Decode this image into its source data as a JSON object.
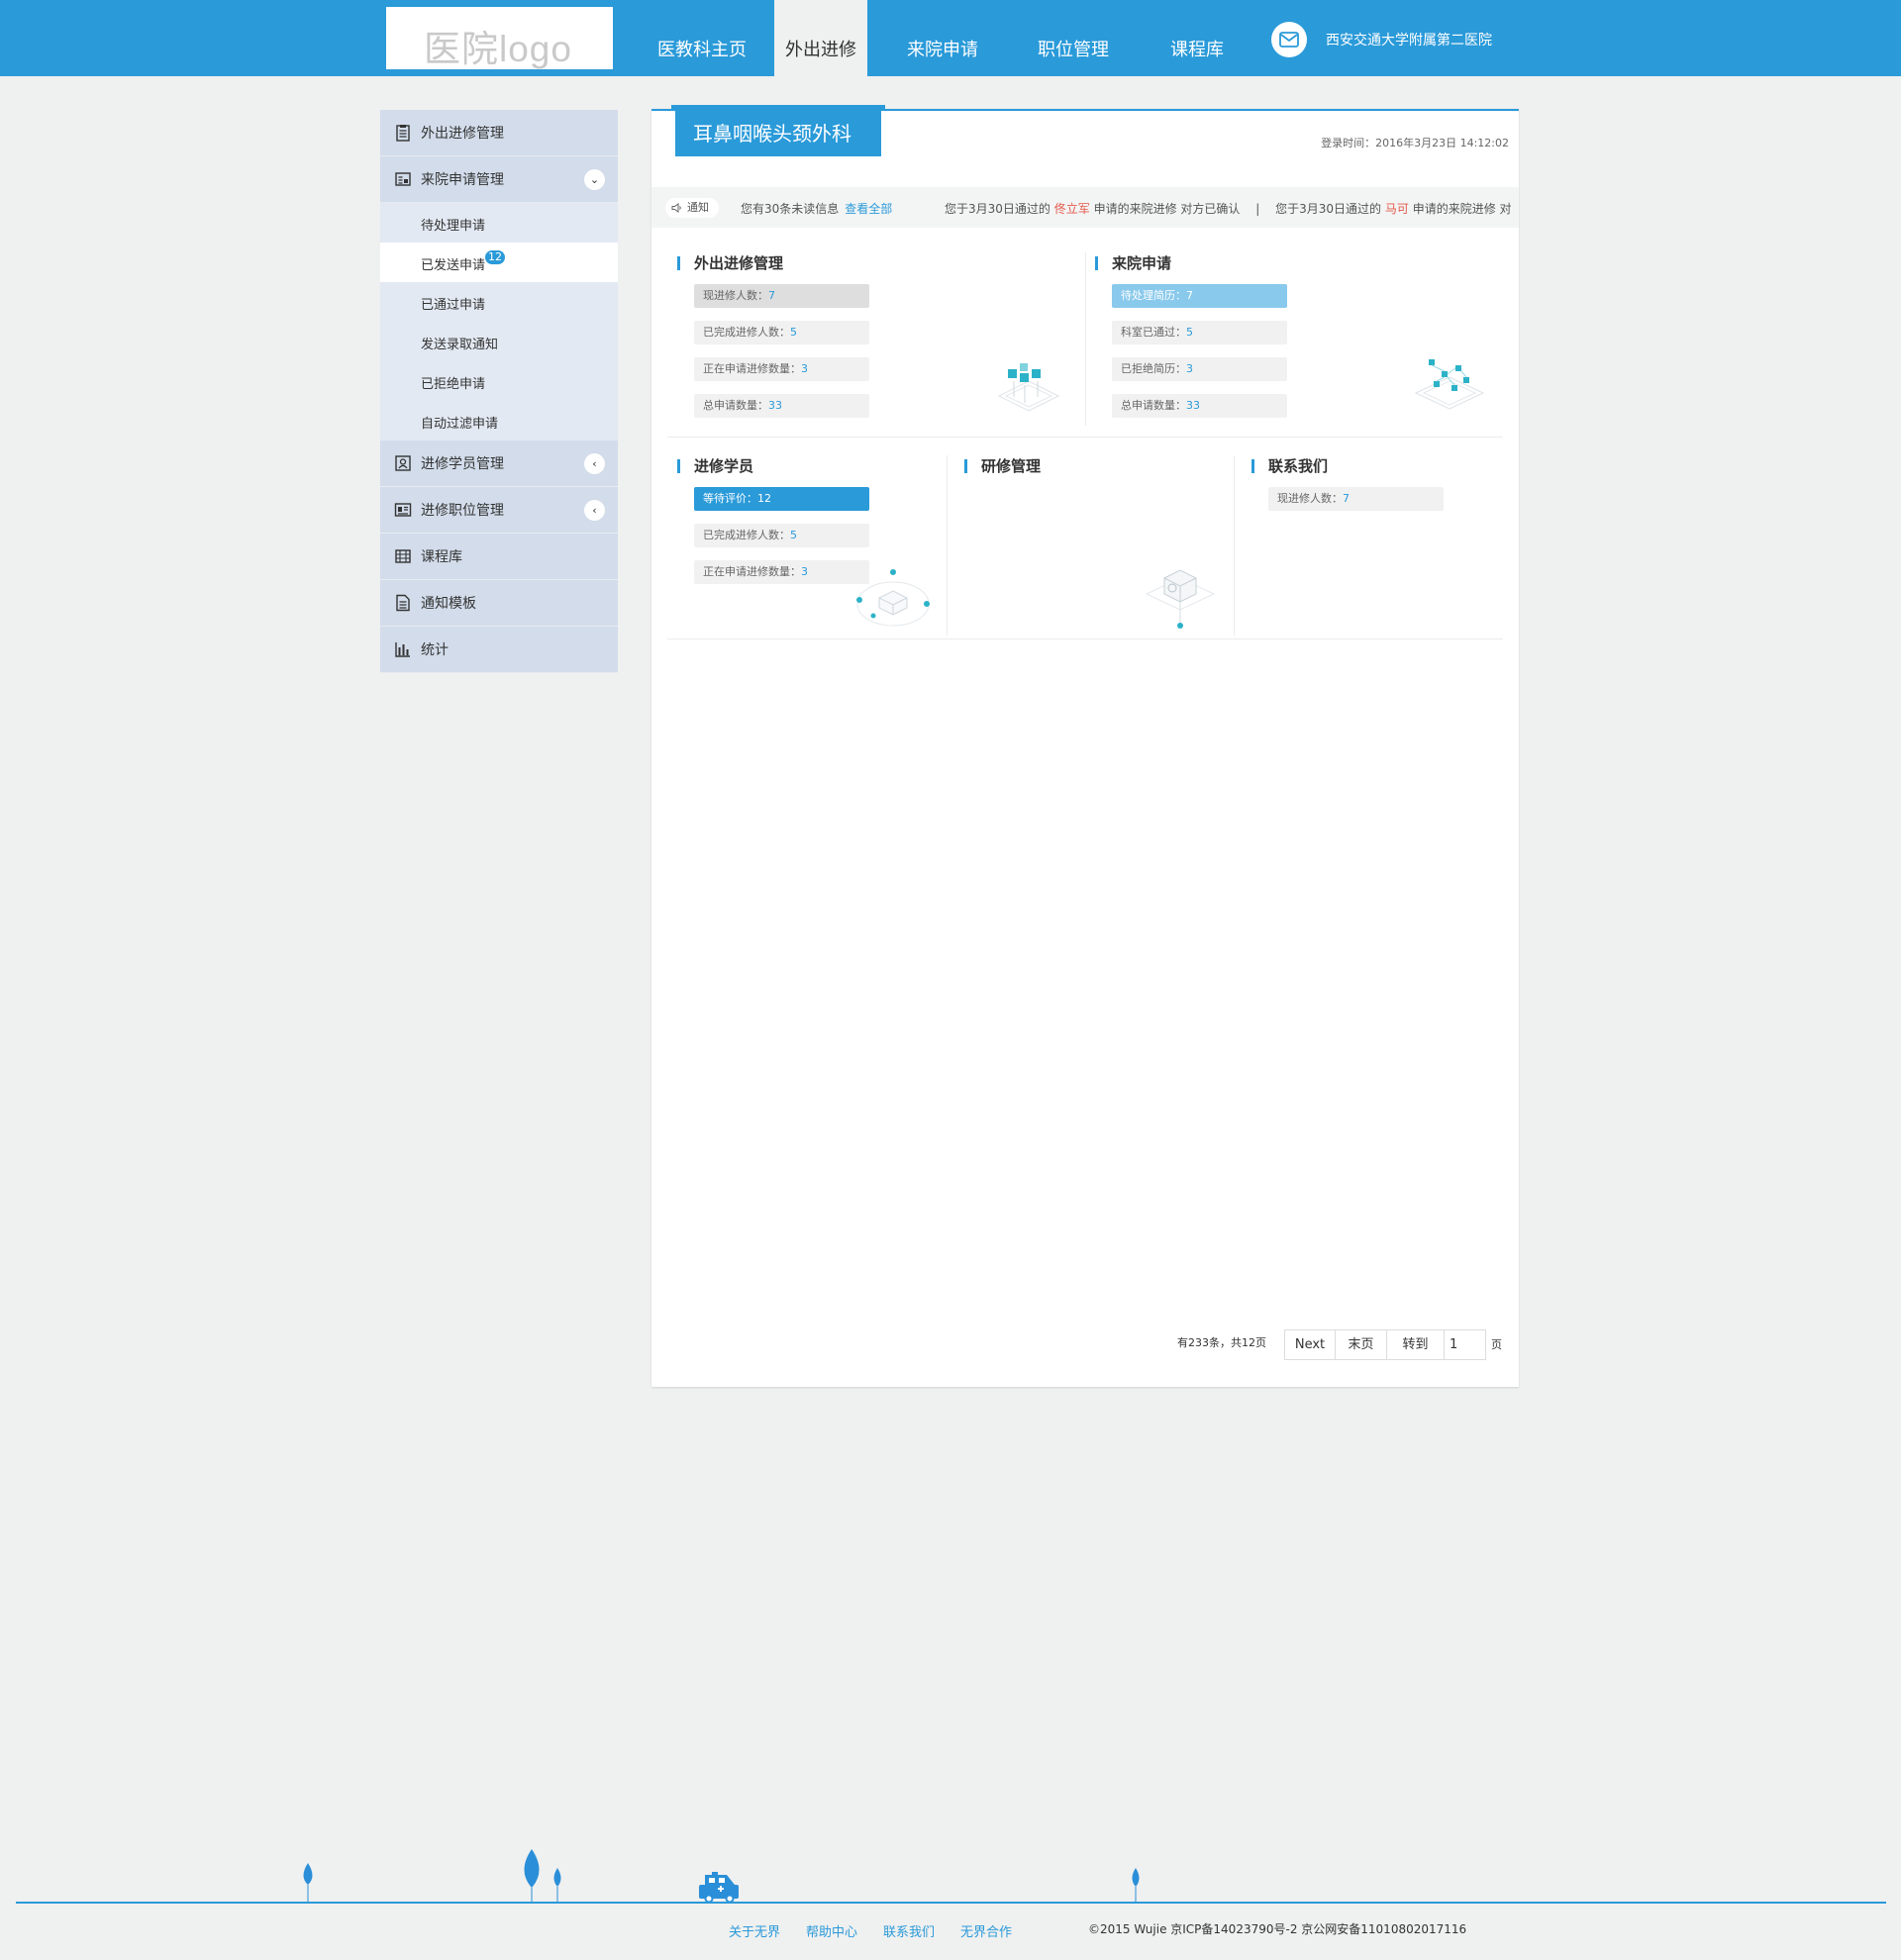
{
  "header": {
    "logo_text": "医院logo",
    "nav": [
      {
        "label": "医教科主页"
      },
      {
        "label": "外出进修"
      },
      {
        "label": "来院申请"
      },
      {
        "label": "职位管理"
      },
      {
        "label": "课程库"
      }
    ],
    "active_nav": "外出进修",
    "hospital_name": "西安交通大学附属第二医院"
  },
  "sidebar": {
    "items": [
      {
        "label": "外出进修管理",
        "icon": "clipboard-icon"
      },
      {
        "label": "来院申请管理",
        "icon": "form-icon",
        "toggle": "expanded"
      },
      {
        "label": "进修学员管理",
        "icon": "id-card-icon",
        "toggle": "collapsed"
      },
      {
        "label": "进修职位管理",
        "icon": "newspaper-icon",
        "toggle": "collapsed"
      },
      {
        "label": "课程库",
        "icon": "book-icon"
      },
      {
        "label": "通知模板",
        "icon": "document-icon"
      },
      {
        "label": "统计",
        "icon": "bar-chart-icon"
      }
    ],
    "subitems": [
      {
        "label": "待处理申请"
      },
      {
        "label": "已发送申请",
        "badge": "12"
      },
      {
        "label": "已通过申请"
      },
      {
        "label": "发送录取通知"
      },
      {
        "label": "已拒绝申请"
      },
      {
        "label": "自动过滤申请"
      }
    ],
    "active_subitem": "已发送申请"
  },
  "panel": {
    "dept_title": "耳鼻咽喉头颈外科",
    "login_time": "登录时间：2016年3月23日 14:12:02",
    "notice": {
      "chip": "通知",
      "unread": "您有30条未读信息",
      "view_all": "查看全部",
      "msg1_pre": "您于3月30日通过的",
      "msg1_name": "佟立军",
      "msg1_post": "申请的来院进修 对方已确认",
      "sep": "|",
      "msg2_pre": "您于3月30日通过的",
      "msg2_name": "马可",
      "msg2_post": "申请的来院进修 对"
    },
    "sections": {
      "outgoing": {
        "title": "外出进修管理",
        "stats": [
          {
            "label": "现进修人数：",
            "value": "7"
          },
          {
            "label": "已完成进修人数：",
            "value": "5"
          },
          {
            "label": "正在申请进修数量：",
            "value": "3"
          },
          {
            "label": "总申请数量：",
            "value": "33"
          }
        ]
      },
      "incoming": {
        "title": "来院申请",
        "stats": [
          {
            "label": "待处理简历：",
            "value": "7"
          },
          {
            "label": "科室已通过：",
            "value": "5"
          },
          {
            "label": "已拒绝简历：",
            "value": "3"
          },
          {
            "label": "总申请数量：",
            "value": "33"
          }
        ]
      },
      "trainees": {
        "title": "进修学员",
        "stats": [
          {
            "label": "等待评价：",
            "value": "12"
          },
          {
            "label": "已完成进修人数：",
            "value": "5"
          },
          {
            "label": "正在申请进修数量：",
            "value": "3"
          }
        ]
      },
      "research": {
        "title": "研修管理"
      },
      "contact": {
        "title": "联系我们",
        "stats": [
          {
            "label": "现进修人数：",
            "value": "7"
          }
        ]
      }
    },
    "pager": {
      "info": "有233条，共12页",
      "next": "Next",
      "last": "末页",
      "goto": "转到",
      "page_value": "1",
      "suffix": "页"
    }
  },
  "footer": {
    "links": [
      "关于无界",
      "帮助中心",
      "联系我们",
      "无界合作"
    ],
    "copyright": "©2015 Wujie 京ICP备14023790号-2  京公网安备11010802017116"
  },
  "colors": {
    "brand_blue": "#2a9ad9",
    "sidebar_bg": "#d2dcea",
    "highlight_red": "#e45a4b"
  }
}
